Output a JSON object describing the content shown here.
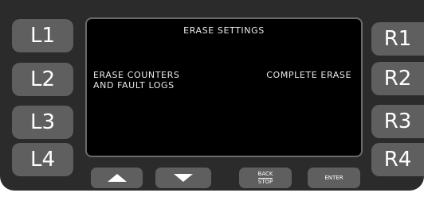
{
  "left_buttons": [
    "L1",
    "L2",
    "L3",
    "L4"
  ],
  "right_buttons": [
    "R1",
    "R2",
    "R3",
    "R4"
  ],
  "screen": {
    "title": "ERASE SETTINGS",
    "left_option_line1": "ERASE COUNTERS",
    "left_option_line2": "AND FAULT LOGS",
    "right_option": "COMPLETE ERASE"
  },
  "bottom_buttons": {
    "up_icon": "up-arrow-icon",
    "down_icon": "down-arrow-icon",
    "back_line1": "BACK",
    "back_line2": "STOP",
    "enter": "ENTER"
  },
  "colors": {
    "bezel": "#2b2b2b",
    "button": "#5f5f5f",
    "screen": "#000000",
    "text": "#e9e9e9"
  }
}
